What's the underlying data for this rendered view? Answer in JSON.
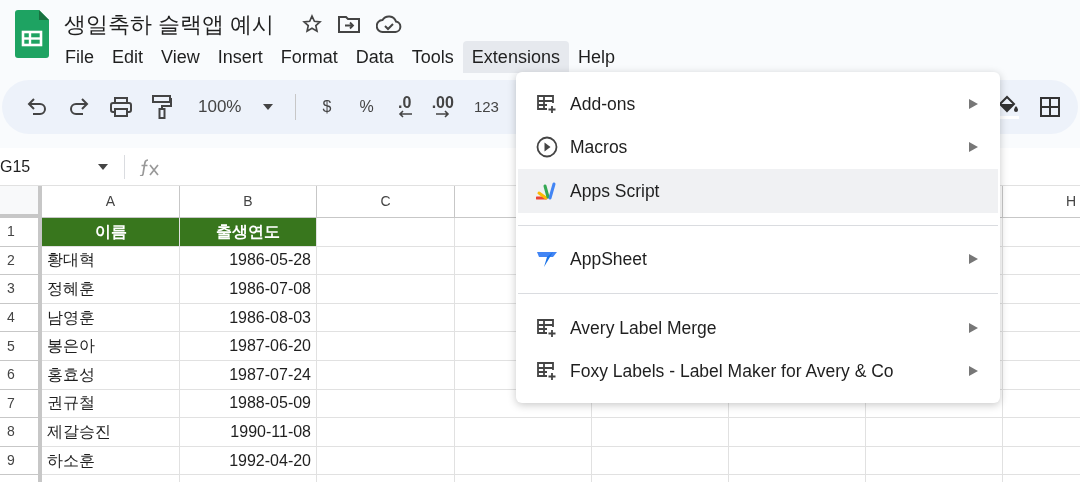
{
  "document": {
    "title": "생일축하 슬랙앱 예시"
  },
  "menu_bar": [
    {
      "label": "File",
      "selected": false
    },
    {
      "label": "Edit",
      "selected": false
    },
    {
      "label": "View",
      "selected": false
    },
    {
      "label": "Insert",
      "selected": false
    },
    {
      "label": "Format",
      "selected": false
    },
    {
      "label": "Data",
      "selected": false
    },
    {
      "label": "Tools",
      "selected": false
    },
    {
      "label": "Extensions",
      "selected": true
    },
    {
      "label": "Help",
      "selected": false
    }
  ],
  "toolbar": {
    "zoom": "100%",
    "currency": "$",
    "percent": "%",
    "decrease_decimal": ".0",
    "increase_decimal": ".00",
    "number_format": "123"
  },
  "formula_bar": {
    "name_box": "G15"
  },
  "sheet": {
    "visible_column_headers": [
      "A",
      "B",
      "C"
    ],
    "right_column_header": "H",
    "rows": [
      {
        "number": "1",
        "header": true,
        "cells": [
          "이름",
          "출생연도"
        ]
      },
      {
        "number": "2",
        "header": false,
        "cells": [
          "황대혁",
          "1986-05-28"
        ]
      },
      {
        "number": "3",
        "header": false,
        "cells": [
          "정혜훈",
          "1986-07-08"
        ]
      },
      {
        "number": "4",
        "header": false,
        "cells": [
          "남영훈",
          "1986-08-03"
        ]
      },
      {
        "number": "5",
        "header": false,
        "cells": [
          "봉은아",
          "1987-06-20"
        ]
      },
      {
        "number": "6",
        "header": false,
        "cells": [
          "홍효성",
          "1987-07-24"
        ]
      },
      {
        "number": "7",
        "header": false,
        "cells": [
          "권규철",
          "1988-05-09"
        ]
      },
      {
        "number": "8",
        "header": false,
        "cells": [
          "제갈승진",
          "1990-11-08"
        ]
      },
      {
        "number": "9",
        "header": false,
        "cells": [
          "하소훈",
          "1992-04-20"
        ]
      }
    ]
  },
  "extensions_menu": [
    [
      {
        "label": "Add-ons",
        "kind": "addon",
        "submenu": true,
        "selected": false
      },
      {
        "label": "Macros",
        "kind": "macro",
        "submenu": true,
        "selected": false
      },
      {
        "label": "Apps Script",
        "kind": "script",
        "submenu": false,
        "selected": true
      }
    ],
    [
      {
        "label": "AppSheet",
        "kind": "appsheet",
        "submenu": true,
        "selected": false
      }
    ],
    [
      {
        "label": "Avery Label Merge",
        "kind": "addon",
        "submenu": true,
        "selected": false
      },
      {
        "label": "Foxy Labels - Label Maker for Avery & Co",
        "kind": "addon",
        "submenu": true,
        "selected": false
      }
    ]
  ]
}
